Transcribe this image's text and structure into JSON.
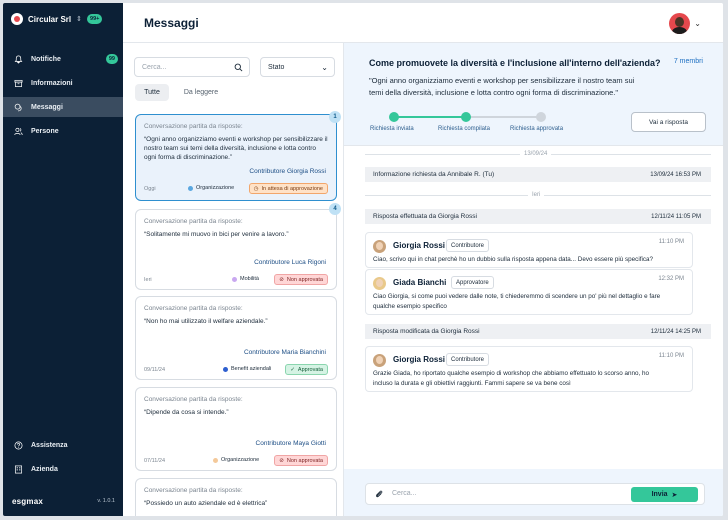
{
  "sidebar": {
    "org_name": "Circular Srl",
    "org_badge": "99+",
    "items": [
      {
        "label": "Notifiche",
        "badge": "99"
      },
      {
        "label": "Informazioni"
      },
      {
        "label": "Messaggi"
      },
      {
        "label": "Persone"
      }
    ],
    "bottom_items": [
      {
        "label": "Assistenza"
      },
      {
        "label": "Azienda"
      }
    ],
    "brand": "esgmax",
    "version": "v. 1.0.1"
  },
  "header": {
    "title": "Messaggi"
  },
  "list": {
    "search_placeholder": "Cerca...",
    "filter_label": "Stato",
    "tabs": [
      "Tutte",
      "Da leggere"
    ],
    "cards": [
      {
        "pre": "Conversazione partita da risposte:",
        "quote": "“Ogni anno organizziamo eventi e workshop per sensibilizzare il nostro team sui temi della diversità, inclusione e lotta contro ogni forma di discriminazione.”",
        "contributor": "Contributore Giorgia Rossi",
        "date": "Oggi",
        "category": "Organizzazione",
        "category_color": "#5aa7e0",
        "status": "In attesa di approvazione",
        "count": "1"
      },
      {
        "pre": "Conversazione partita da risposte:",
        "quote": "“Solitamente mi muovo in bici per venire a lavoro.”",
        "contributor": "Contributore Luca Rigoni",
        "date": "Ieri",
        "category": "Mobilità",
        "category_color": "#c9a8f0",
        "status": "Non approvata",
        "count": "4"
      },
      {
        "pre": "Conversazione partita da risposte:",
        "quote": "“Non ho mai utilizzato il welfare aziendale.”",
        "contributor": "Contributore Maria Bianchini",
        "date": "09/11/24",
        "category": "Benefit aziendali",
        "category_color": "#2e5fcf",
        "status": "Approvata"
      },
      {
        "pre": "Conversazione partita da risposte:",
        "quote": "“Dipende da cosa si intende.”",
        "contributor": "Contributore Maya Giotti",
        "date": "07/11/24",
        "category": "Organizzazione",
        "category_color": "#f4c99a",
        "status": "Non approvata"
      },
      {
        "pre": "Conversazione partita da risposte:",
        "quote": "“Possiedo un auto aziendale ed è elettrica”"
      }
    ]
  },
  "detail": {
    "title": "Come promuovete la diversità e l'inclusione all'interno dell'azienda?",
    "members": "7 membri",
    "quote": "\"Ogni anno organizziamo eventi e workshop per sensibilizzare il nostro team sui temi della diversità, inclusione e lotta contro ogni forma di discriminazione.\"",
    "steps": [
      "Richiesta inviata",
      "Richiesta compilata",
      "Richiesta approvata"
    ],
    "go_button": "Vai a risposta",
    "dividers": [
      "13/09/24",
      "Ieri"
    ],
    "events": [
      {
        "text": "Informazione richiesta da Annibale R. (Tu)",
        "time": "13/09/24 16:53 PM"
      },
      {
        "text": "Risposta effettuata da Giorgia Rossi",
        "time": "12/11/24 11:05 PM"
      },
      {
        "text": "Risposta modificata da Giorgia Rossi",
        "time": "12/11/24 14:25 PM"
      }
    ],
    "messages": [
      {
        "name": "Giorgia Rossi",
        "role": "Contributore",
        "time": "11:10 PM",
        "text": "Ciao, scrivo qui in chat perchè ho un dubbio sulla risposta appena data... Devo essere più specifica?"
      },
      {
        "name": "Giada Bianchi",
        "role": "Approvatore",
        "time": "12:32 PM",
        "text_1": "Ciao Giorgia, si come puoi vedere dalle note, ti chiederemmo di scendere un po' più nel dettaglio e fare",
        "text_2": "qualche esempio specifico"
      },
      {
        "name": "Giorgia Rossi",
        "role": "Contributore",
        "time": "11:10 PM",
        "text_1": "Grazie Giada, ho riportato qualche esempio di workshop che abbiamo effettuato lo scorso anno, ho",
        "text_2": "incluso la durata e gli obiettivi raggiunti. Fammi sapere se va bene così"
      }
    ],
    "composer_placeholder": "Cerca...",
    "send_label": "Invia"
  }
}
